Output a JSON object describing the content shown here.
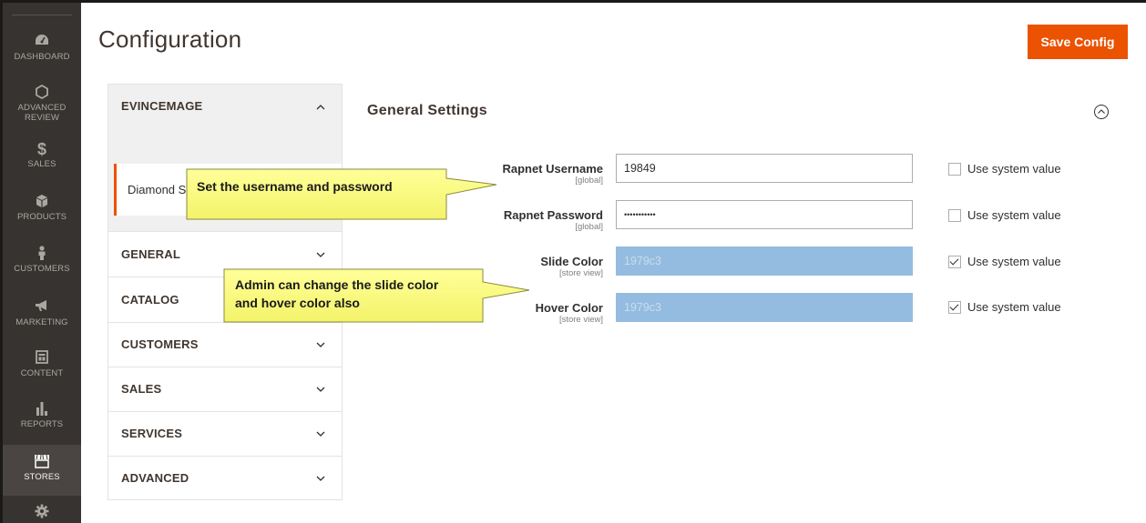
{
  "sidebar": {
    "items": [
      {
        "label": "DASHBOARD",
        "icon": "dashboard-icon"
      },
      {
        "label": "ADVANCED REVIEW",
        "line1": "ADVANCED",
        "line2": "REVIEW",
        "icon": "hexagon-icon"
      },
      {
        "label": "SALES",
        "icon": "dollar-icon"
      },
      {
        "label": "PRODUCTS",
        "icon": "cube-icon"
      },
      {
        "label": "CUSTOMERS",
        "icon": "person-icon"
      },
      {
        "label": "MARKETING",
        "icon": "megaphone-icon"
      },
      {
        "label": "CONTENT",
        "icon": "layout-icon"
      },
      {
        "label": "REPORTS",
        "icon": "bar-chart-icon"
      },
      {
        "label": "STORES",
        "icon": "store-icon"
      },
      {
        "label": "",
        "icon": "gear-icon"
      }
    ],
    "active": "STORES"
  },
  "header": {
    "title": "Configuration",
    "save_label": "Save Config"
  },
  "tabs": {
    "open_group": {
      "label": "EVINCEMAGE",
      "item": "Diamond S"
    },
    "groups": [
      {
        "label": "GENERAL"
      },
      {
        "label": "CATALOG"
      },
      {
        "label": "CUSTOMERS"
      },
      {
        "label": "SALES"
      },
      {
        "label": "SERVICES"
      },
      {
        "label": "ADVANCED"
      }
    ]
  },
  "section": {
    "title": "General Settings",
    "fields": [
      {
        "label": "Rapnet Username",
        "scope": "[global]",
        "value": "19849",
        "disabled": false,
        "use_system": false,
        "use_system_label": "Use system value"
      },
      {
        "label": "Rapnet Password",
        "scope": "[global]",
        "value": "•••••••••••",
        "disabled": false,
        "use_system": false,
        "use_system_label": "Use system value"
      },
      {
        "label": "Slide Color",
        "scope": "[store view]",
        "value": "1979c3",
        "disabled": true,
        "use_system": true,
        "use_system_label": "Use system value"
      },
      {
        "label": "Hover Color",
        "scope": "[store view]",
        "value": "1979c3",
        "disabled": true,
        "use_system": true,
        "use_system_label": "Use system value"
      }
    ]
  },
  "callouts": {
    "first": {
      "text": "Set the username and password"
    },
    "second": {
      "line1": "Admin can change the slide color",
      "line2": "and hover color also"
    }
  },
  "colors": {
    "accent": "#eb5202",
    "sidebar_bg": "#373330",
    "disabled_field": "#94bce0",
    "callout_fill": "#ffff88"
  }
}
